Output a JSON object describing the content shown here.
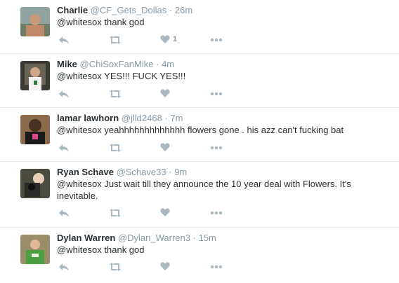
{
  "tweets": [
    {
      "name": "Charlie",
      "handle": "@CF_Gets_Dollas",
      "sep": "·",
      "time": "26m",
      "text": "@whitesox thank god",
      "like_count": "1"
    },
    {
      "name": "Mike",
      "handle": "@ChiSoxFanMike",
      "sep": "·",
      "time": "4m",
      "text": "@whitesox YES!!! FUCK YES!!!",
      "like_count": ""
    },
    {
      "name": "lamar lawhorn",
      "handle": "@jlld2468",
      "sep": "·",
      "time": "7m",
      "text": "@whitesox yeahhhhhhhhhhhhh flowers gone . his azz can't fucking bat",
      "like_count": ""
    },
    {
      "name": "Ryan Schave",
      "handle": "@Schave33",
      "sep": "·",
      "time": "9m",
      "text": "@whitesox Just wait till they announce the 10 year deal with Flowers.  It's inevitable.",
      "like_count": ""
    },
    {
      "name": "Dylan Warren",
      "handle": "@Dylan_Warren3",
      "sep": "·",
      "time": "15m",
      "text": "@whitesox thank god",
      "like_count": ""
    }
  ],
  "icons": {
    "reply": "reply-icon",
    "retweet": "retweet-icon",
    "like": "heart-icon",
    "more": "more-icon"
  },
  "colors": {
    "icon": "#aab8c2",
    "meta": "#8899a6",
    "divider": "#e1e8ed",
    "text": "#292f33"
  }
}
